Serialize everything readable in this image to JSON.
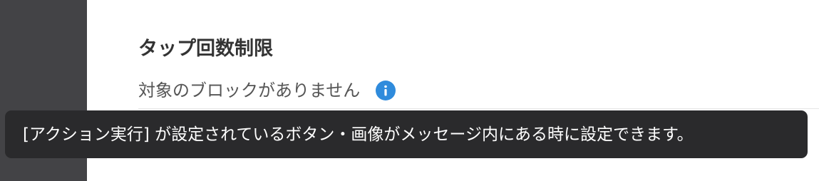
{
  "sidebar": {
    "check_icon": "checkmark-icon"
  },
  "settings": {
    "title": "タップ回数制限",
    "status_text": "対象のブロックがありません",
    "info_icon": "info-icon"
  },
  "tooltip": {
    "text": "[アクション実行] が設定されているボタン・画像がメッセージ内にある時に設定できます。"
  },
  "colors": {
    "sidebar_bg": "#434346",
    "info_icon": "#2f8bdc",
    "tooltip_bg": "#2a2a2c"
  }
}
